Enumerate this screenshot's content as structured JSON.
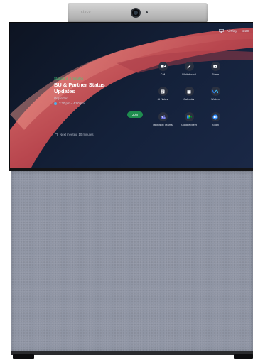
{
  "camera": {
    "brand": "cisco"
  },
  "status_bar": {
    "airplay_label": "AirPlay",
    "time": "2:20"
  },
  "meeting": {
    "status": "Starting in 2 minutes",
    "title_line1": "BU & Partner Status",
    "title_line2": "Updates",
    "organizer": "Organizer",
    "time_range": "3:20 pm – 4:00 pm",
    "next_text": "Next meeting 10 minutes",
    "join_label": "Join"
  },
  "apps": [
    {
      "label": "Call",
      "icon": "video-icon"
    },
    {
      "label": "Whiteboard",
      "icon": "pencil-icon"
    },
    {
      "label": "Share",
      "icon": "share-icon"
    },
    {
      "label": "AI Notes",
      "icon": "notes-icon"
    },
    {
      "label": "Calendar",
      "icon": "calendar-icon"
    },
    {
      "label": "Webex",
      "icon": "webex-icon"
    },
    {
      "label": "Microsoft Teams",
      "icon": "teams-icon"
    },
    {
      "label": "Google Meet",
      "icon": "google-meet-icon"
    },
    {
      "label": "Zoom",
      "icon": "zoom-icon"
    }
  ],
  "colors": {
    "accent": "#1f8e4f",
    "ribbon": "#c85a5e",
    "background": "#14213a"
  }
}
